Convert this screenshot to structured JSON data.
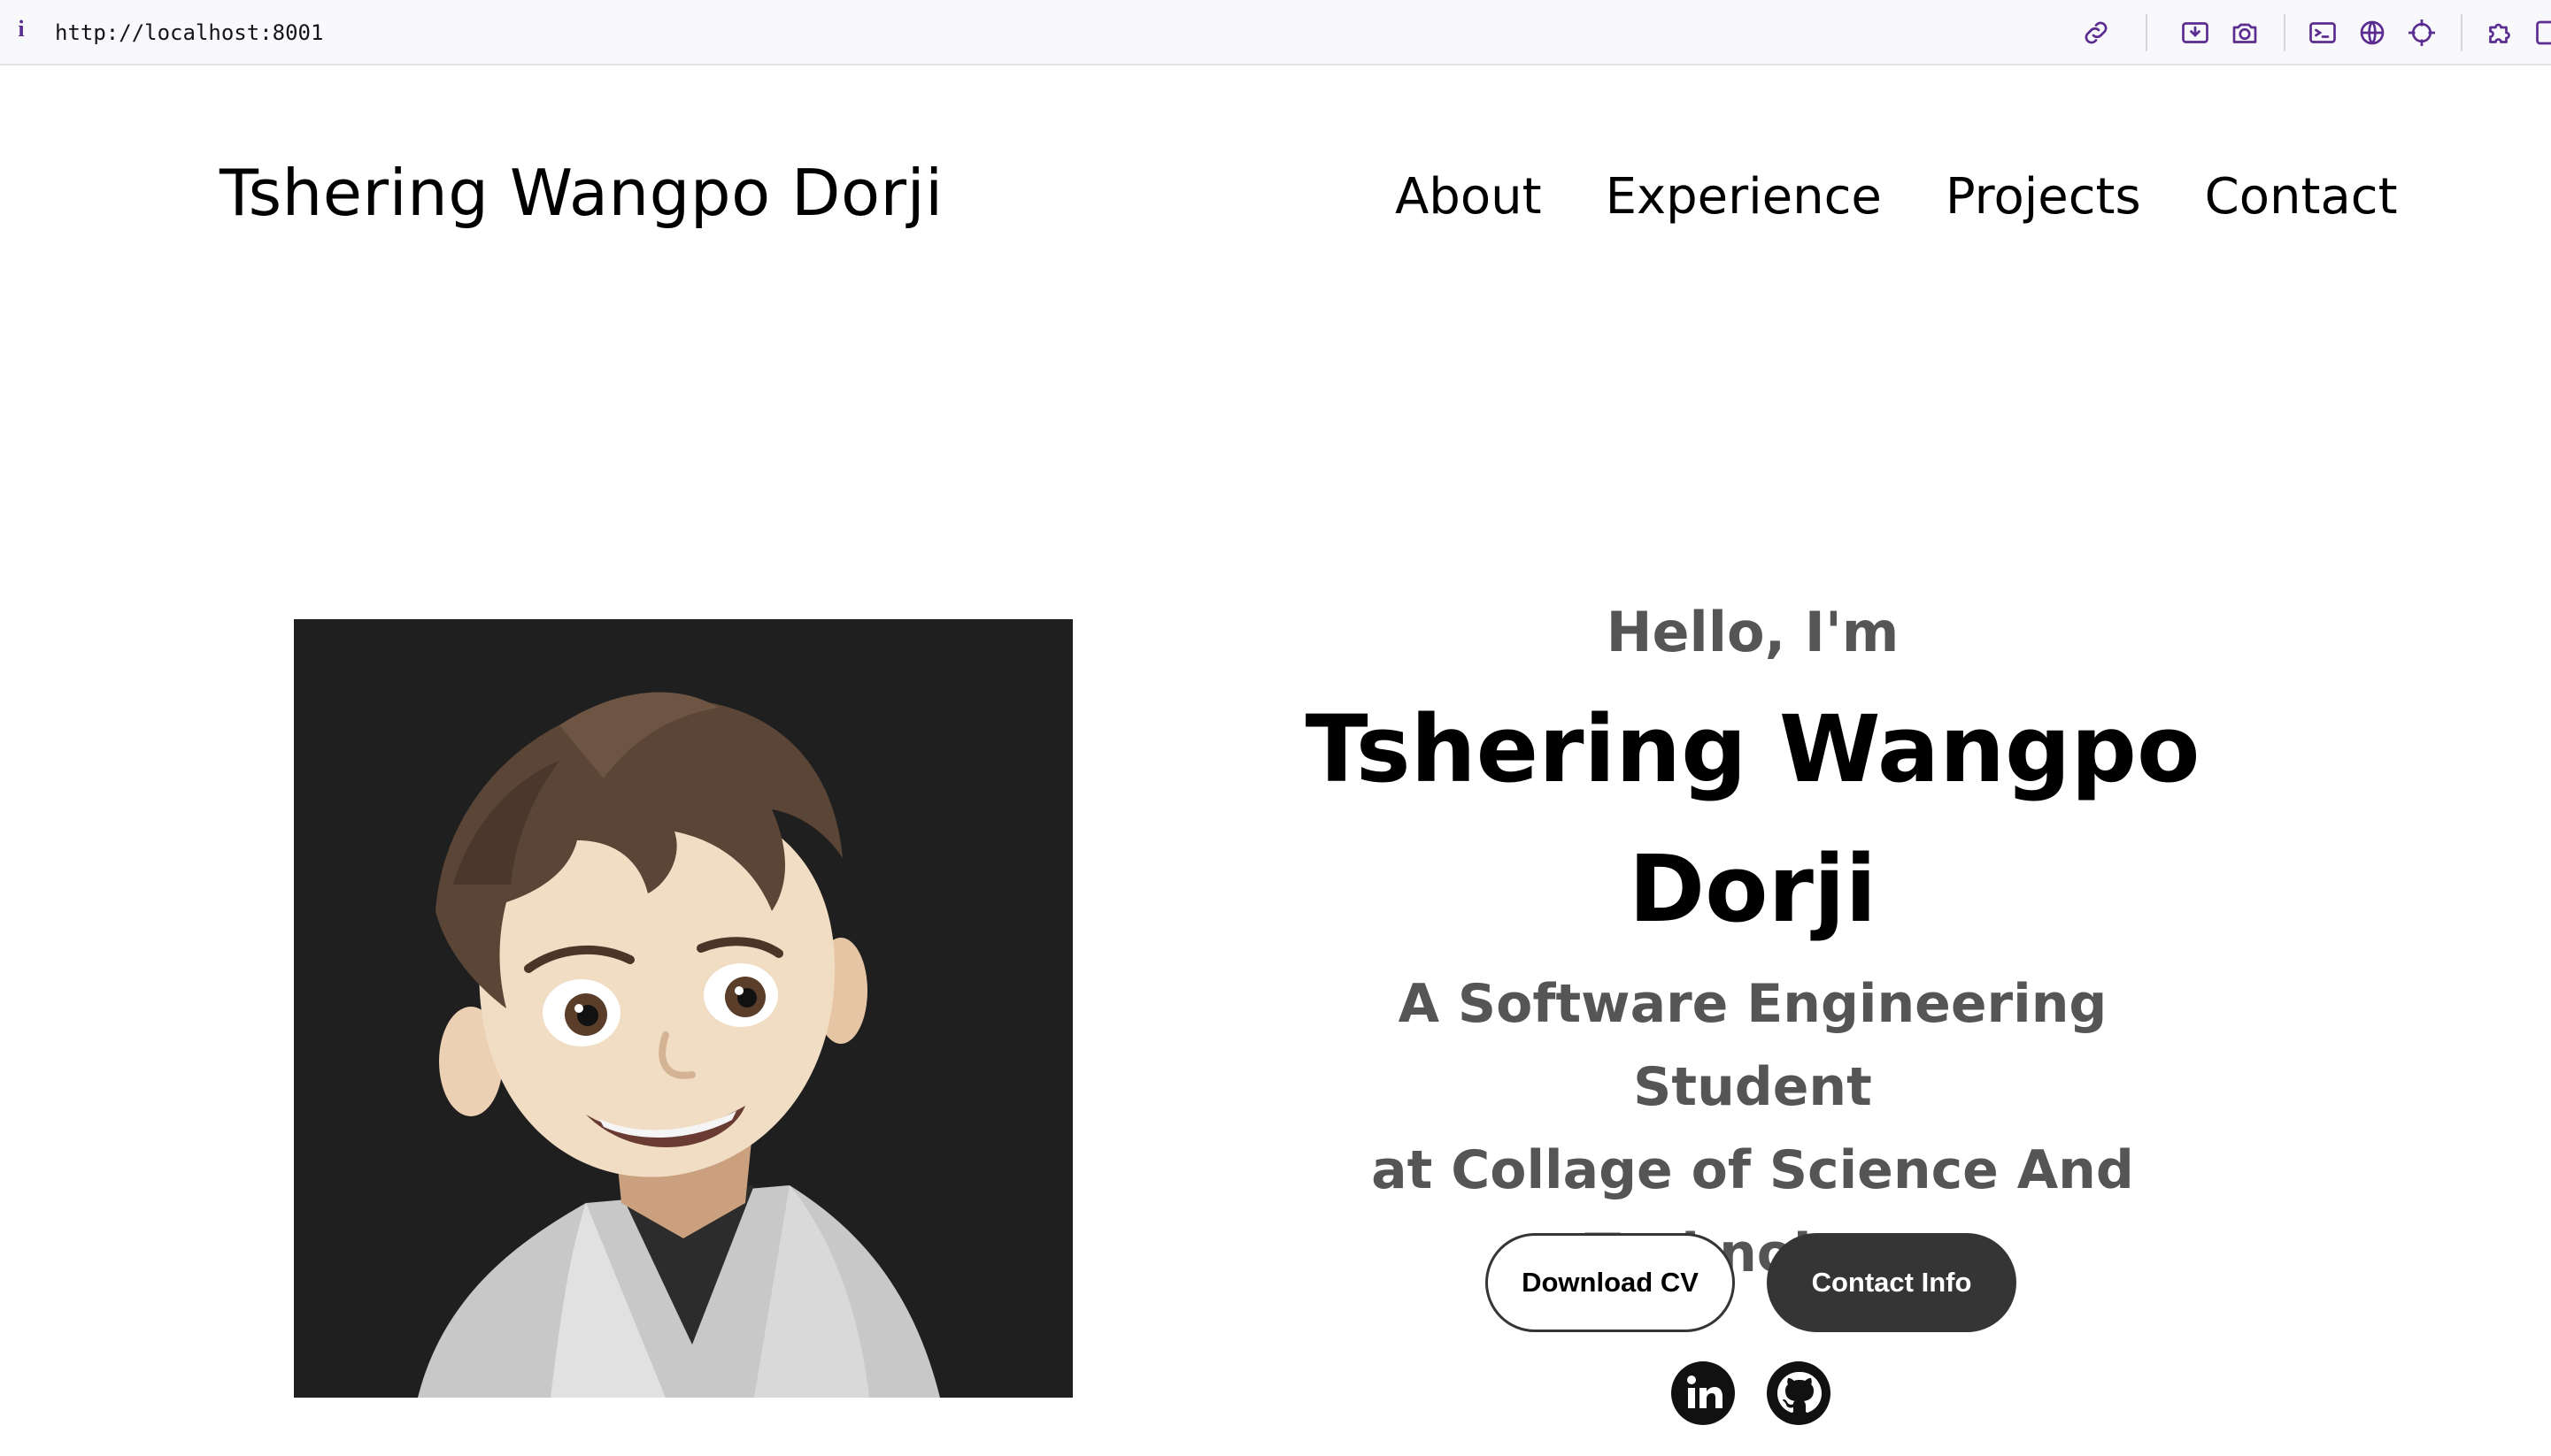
{
  "browser": {
    "url": "http://localhost:8001",
    "info_icon": "i"
  },
  "site": {
    "logo": "Tshering Wangpo Dorji",
    "nav": [
      "About",
      "Experience",
      "Projects",
      "Contact"
    ]
  },
  "hero": {
    "greeting": "Hello, I'm",
    "name_line1": "Tshering Wangpo",
    "name_line2": "Dorji",
    "subtitle_line1": "A Software Engineering Student",
    "subtitle_line2": "at Collage of Science And",
    "subtitle_line3": "Technology",
    "buttons": {
      "download": "Download CV",
      "contact": "Contact Info"
    },
    "socials": [
      "linkedin-icon",
      "github-icon"
    ]
  },
  "colors": {
    "accent_dark": "#353535",
    "muted_text": "#555555",
    "photo_bg": "#1f1f1f"
  }
}
